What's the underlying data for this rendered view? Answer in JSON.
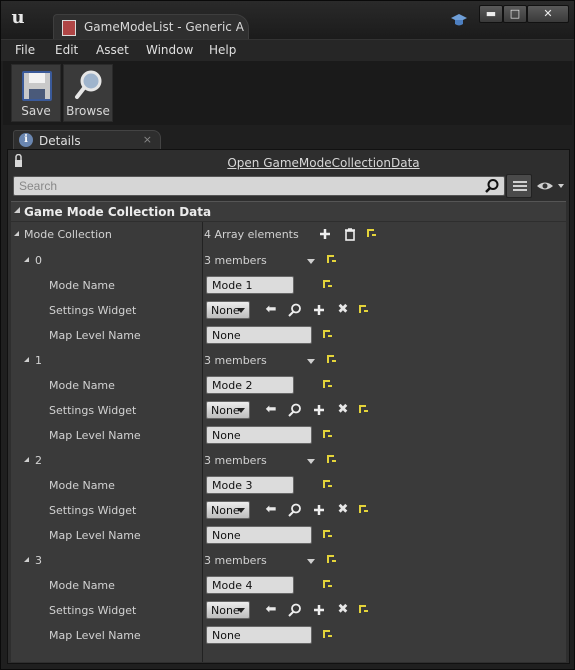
{
  "window": {
    "tab_title": "GameModeList - Generic A",
    "logo_letter": "u",
    "min_glyph": "▬",
    "max_glyph": "□",
    "close_glyph": "✕"
  },
  "menu": [
    "File",
    "Edit",
    "Asset",
    "Window",
    "Help"
  ],
  "toolbar": {
    "save_label": "Save",
    "browse_label": "Browse"
  },
  "details_tab": {
    "label": "Details",
    "close": "×",
    "info_glyph": "i"
  },
  "panel": {
    "open_link": "Open GameModeCollectionData",
    "search_placeholder": "Search"
  },
  "category": {
    "label": "Game Mode Collection Data"
  },
  "mode_collection": {
    "label": "Mode Collection",
    "value": "4 Array elements"
  },
  "element_labels": {
    "mode_name": "Mode Name",
    "settings_widget": "Settings Widget",
    "map_level_name": "Map Level Name"
  },
  "elements": [
    {
      "index": "0",
      "members": "3 members",
      "mode_name": "Mode 1",
      "settings_widget": "None",
      "map_level_name": "None"
    },
    {
      "index": "1",
      "members": "3 members",
      "mode_name": "Mode 2",
      "settings_widget": "None",
      "map_level_name": "None"
    },
    {
      "index": "2",
      "members": "3 members",
      "mode_name": "Mode 3",
      "settings_widget": "None",
      "map_level_name": "None"
    },
    {
      "index": "3",
      "members": "3 members",
      "mode_name": "Mode 4",
      "settings_widget": "None",
      "map_level_name": "None"
    }
  ],
  "widget_tool_glyphs": {
    "back": "⬅",
    "clear": "✖"
  },
  "colors": {
    "reset_arrow": "#e4d43a",
    "background": "#3a3a3a",
    "field": "#dcdcdc"
  }
}
